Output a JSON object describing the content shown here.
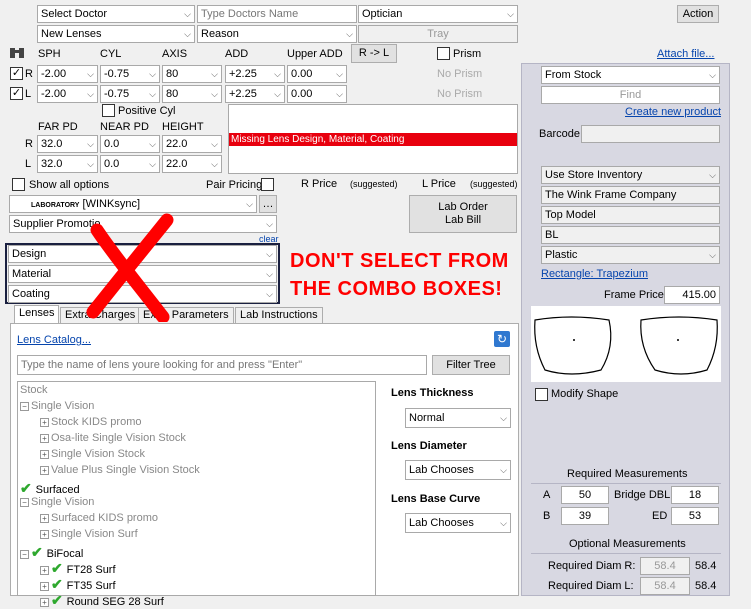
{
  "top": {
    "doctor": "Select Doctor",
    "doctor_name_placeholder": "Type Doctors Name",
    "role": "Optician",
    "action": "Action",
    "lens_type": "New Lenses",
    "reason": "Reason",
    "tray": "Tray"
  },
  "rx": {
    "headers": [
      "SPH",
      "CYL",
      "AXIS",
      "ADD",
      "Upper ADD"
    ],
    "r_to_l": "R -> L",
    "prism_label": "Prism",
    "no_prism": "No Prism",
    "right": {
      "eye": "R",
      "sph": "-2.00",
      "cyl": "-0.75",
      "axis": "80",
      "add": "+2.25",
      "upper_add": "0.00"
    },
    "left": {
      "eye": "L",
      "sph": "-2.00",
      "cyl": "-0.75",
      "axis": "80",
      "add": "+2.25",
      "upper_add": "0.00"
    },
    "positive_cyl": "Positive Cyl",
    "pd_headers": [
      "FAR PD",
      "NEAR PD",
      "HEIGHT"
    ],
    "pd_right": {
      "far": "32.0",
      "near": "0.0",
      "height": "22.0"
    },
    "pd_left": {
      "far": "32.0",
      "near": "0.0",
      "height": "22.0"
    },
    "missing_msg": "Missing Lens Design, Material, Coating"
  },
  "options": {
    "show_all": "Show all options",
    "pair_pricing": "Pair Pricing",
    "r_price": "R Price",
    "l_price": "L Price",
    "suggested": "(suggested)",
    "laboratory_label": "LABORATORY",
    "laboratory": "[WINKsync]",
    "supplier_promotion": "Supplier Promotio",
    "clear": "clear",
    "design": "Design",
    "material": "Material",
    "coating": "Coating",
    "lab_order": "Lab Order",
    "lab_bill": "Lab Bill",
    "annotation_line1": "DON'T SELECT FROM",
    "annotation_line2": "THE COMBO BOXES!"
  },
  "tabs": [
    "Lenses",
    "Extra Charges",
    "Extra Parameters",
    "Lab Instructions"
  ],
  "lens_panel": {
    "catalog_link": "Lens Catalog...",
    "search_placeholder": "Type the name of lens youre looking for and press \"Enter\"",
    "filter_tree": "Filter Tree",
    "tree": [
      {
        "label": "Stock",
        "level": 0,
        "style": "gray",
        "icon": "none"
      },
      {
        "label": "Single Vision",
        "level": 0,
        "style": "gray",
        "icon": "collapse"
      },
      {
        "label": "Stock KIDS promo",
        "level": 1,
        "style": "gray",
        "icon": "expand"
      },
      {
        "label": "Osa-lite Single Vision Stock",
        "level": 1,
        "style": "gray",
        "icon": "expand"
      },
      {
        "label": "Single Vision Stock",
        "level": 1,
        "style": "gray",
        "icon": "expand"
      },
      {
        "label": "Value Plus Single Vision Stock",
        "level": 1,
        "style": "gray",
        "icon": "expand"
      },
      {
        "label": "Surfaced",
        "level": 0,
        "style": "normal",
        "icon": "check"
      },
      {
        "label": "Single Vision",
        "level": 0,
        "style": "gray",
        "icon": "collapse"
      },
      {
        "label": "Surfaced KIDS promo",
        "level": 1,
        "style": "gray",
        "icon": "expand"
      },
      {
        "label": "Single Vision Surf",
        "level": 1,
        "style": "gray",
        "icon": "expand"
      },
      {
        "label": "BiFocal",
        "level": 0,
        "style": "normal",
        "icon": "collapse-check"
      },
      {
        "label": "FT28 Surf",
        "level": 1,
        "style": "normal",
        "icon": "expand-check"
      },
      {
        "label": "FT35 Surf",
        "level": 1,
        "style": "normal",
        "icon": "expand-check"
      },
      {
        "label": "Round SEG 28 Surf",
        "level": 1,
        "style": "normal",
        "icon": "expand-check"
      }
    ],
    "thickness_label": "Lens Thickness",
    "thickness": "Normal",
    "diameter_label": "Lens Diameter",
    "diameter": "Lab Chooses",
    "base_curve_label": "Lens Base Curve",
    "base_curve": "Lab Chooses"
  },
  "frame": {
    "attach_file": "Attach file...",
    "source": "From Stock",
    "find": "Find",
    "create_product": "Create new product",
    "barcode_label": "Barcode",
    "inventory": "Use Store Inventory",
    "company": "The Wink Frame Company",
    "model": "Top Model",
    "color": "BL",
    "material": "Plastic",
    "shape": "Rectangle: Trapezium",
    "price_label": "Frame Price",
    "price": "415.00",
    "modify_shape": "Modify Shape",
    "required_title": "Required Measurements",
    "a_label": "A",
    "a": "50",
    "bridge_label": "Bridge DBL",
    "bridge": "18",
    "b_label": "B",
    "b": "39",
    "ed_label": "ED",
    "ed": "53",
    "optional_title": "Optional Measurements",
    "diam_r_label": "Required Diam R:",
    "diam_r": "58.4",
    "diam_r_val": "58.4",
    "diam_l_label": "Required Diam L:",
    "diam_l": "58.4",
    "diam_l_val": "58.4"
  },
  "colors": {
    "missing_bg": "#e8000e",
    "annotation": "#ff0000",
    "link": "#0645ad",
    "check": "#2ea82e"
  }
}
